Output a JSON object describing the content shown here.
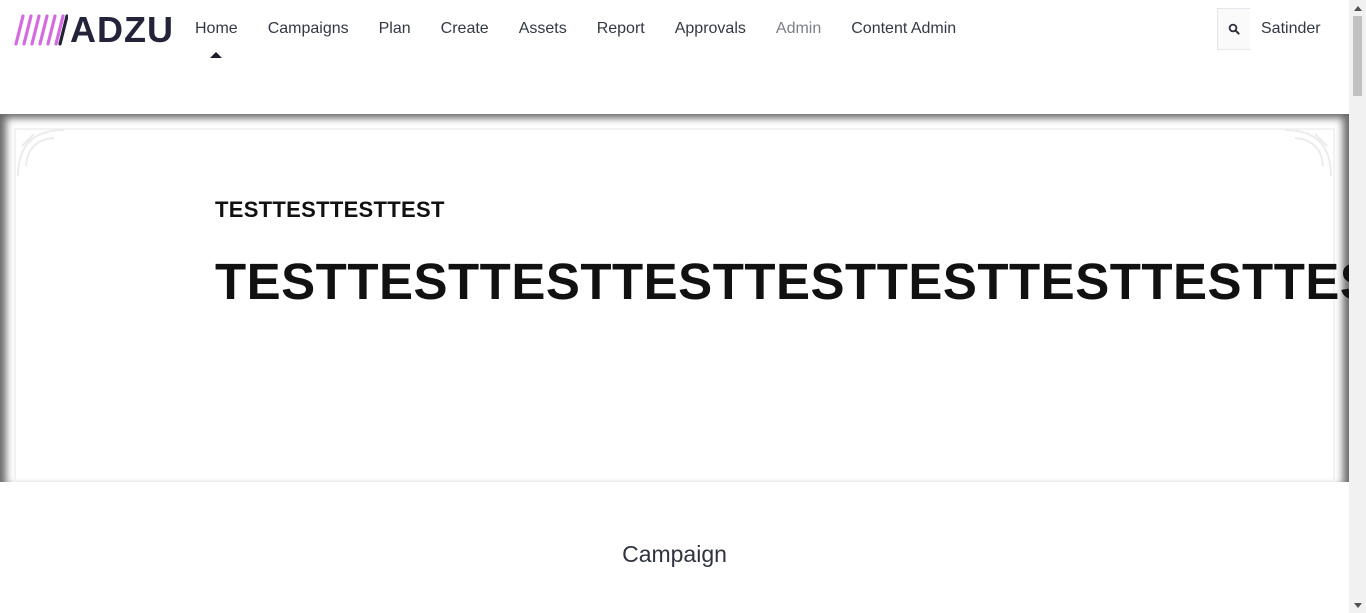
{
  "brand": {
    "name": "ADZU",
    "accent": "#d66be0"
  },
  "nav": {
    "items": [
      {
        "label": "Home",
        "state": "active"
      },
      {
        "label": "Campaigns",
        "state": ""
      },
      {
        "label": "Plan",
        "state": ""
      },
      {
        "label": "Create",
        "state": ""
      },
      {
        "label": "Assets",
        "state": ""
      },
      {
        "label": "Report",
        "state": ""
      },
      {
        "label": "Approvals",
        "state": ""
      },
      {
        "label": "Admin",
        "state": "muted"
      },
      {
        "label": "Content Admin",
        "state": ""
      }
    ]
  },
  "header": {
    "search_icon": "search-icon",
    "user_name": "Satinder"
  },
  "hero": {
    "subtitle": "TESTTESTTESTTEST",
    "title": "TESTTESTTESTTESTTESTTESTTESTTESTTEST"
  },
  "section": {
    "title": "Campaign"
  }
}
